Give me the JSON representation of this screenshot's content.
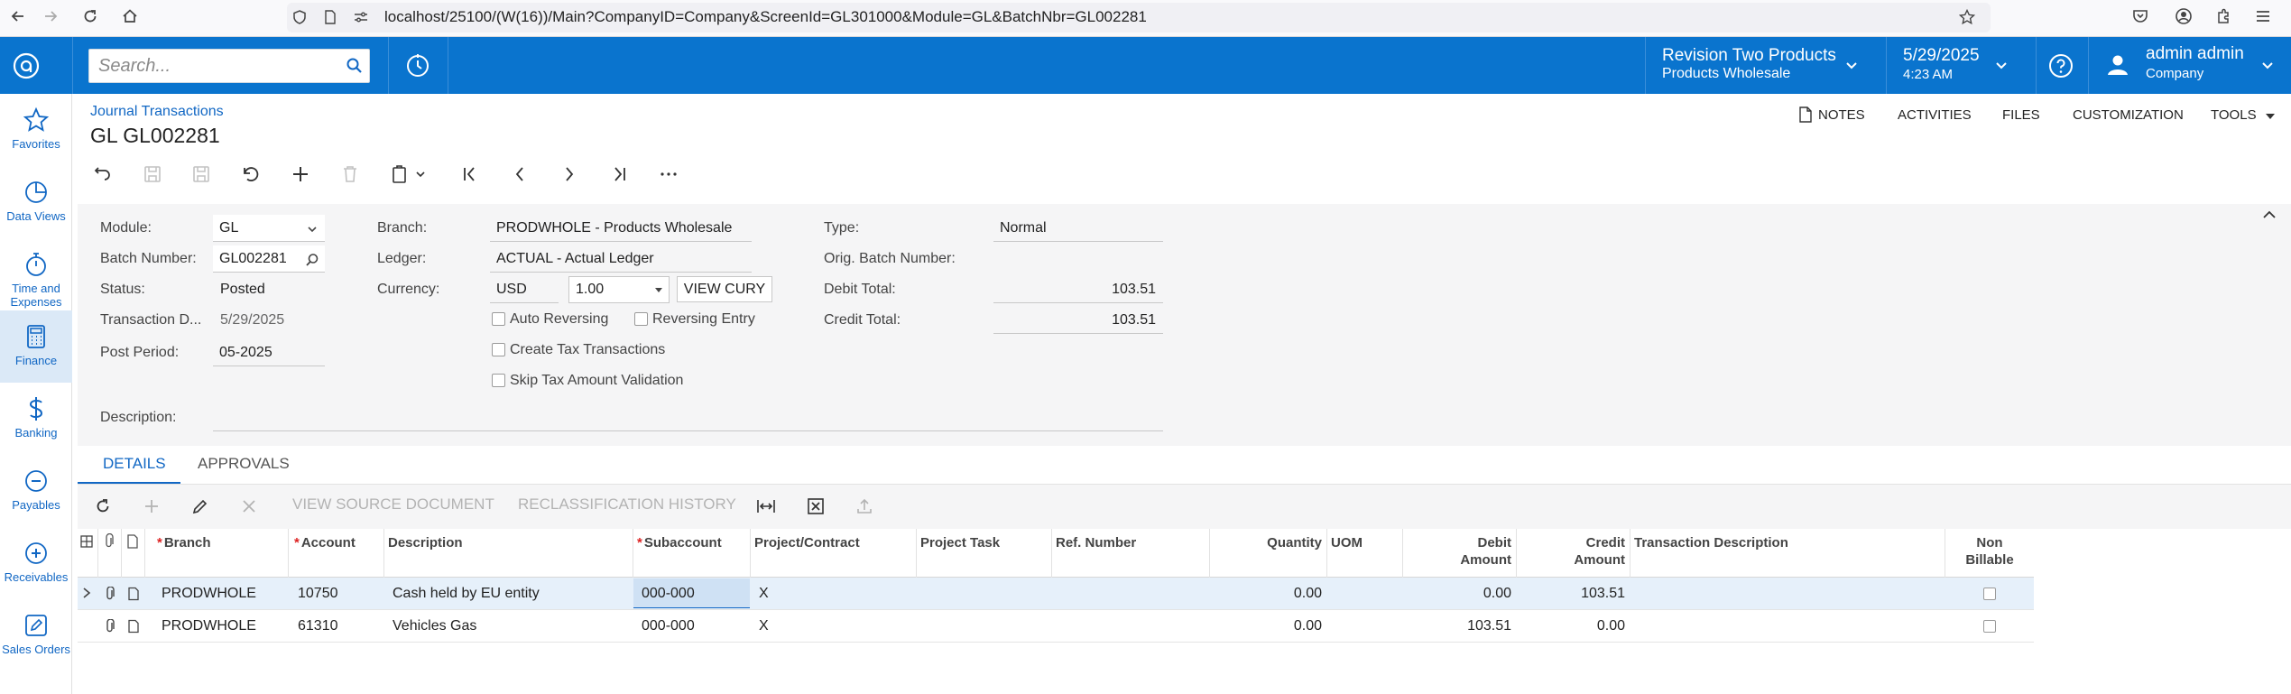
{
  "browser": {
    "url": "localhost/25100/(W(16))/Main?CompanyID=Company&ScreenId=GL301000&Module=GL&BatchNbr=GL002281"
  },
  "topbar": {
    "search_placeholder": "Search...",
    "company_name": "Revision Two Products",
    "company_branch": "Products Wholesale",
    "date": "5/29/2025",
    "time": "4:23 AM",
    "user_name": "admin admin",
    "user_company": "Company"
  },
  "sidebar": {
    "items": [
      {
        "label": "Favorites",
        "icon": "star-icon"
      },
      {
        "label": "Data Views",
        "icon": "pie-chart-icon"
      },
      {
        "label": "Time and Expenses",
        "icon": "stopwatch-icon"
      },
      {
        "label": "Finance",
        "icon": "calculator-icon"
      },
      {
        "label": "Banking",
        "icon": "dollar-icon"
      },
      {
        "label": "Payables",
        "icon": "minus-circle-icon"
      },
      {
        "label": "Receivables",
        "icon": "plus-circle-icon"
      },
      {
        "label": "Sales Orders",
        "icon": "pencil-icon"
      }
    ]
  },
  "header": {
    "breadcrumb": "Journal Transactions",
    "title": "GL GL002281",
    "menu": {
      "notes": "NOTES",
      "activities": "ACTIVITIES",
      "files": "FILES",
      "customization": "CUSTOMIZATION",
      "tools": "TOOLS"
    }
  },
  "form": {
    "module_label": "Module:",
    "module_value": "GL",
    "batch_label": "Batch Number:",
    "batch_value": "GL002281",
    "status_label": "Status:",
    "status_value": "Posted",
    "trandate_label": "Transaction D...",
    "trandate_value": "5/29/2025",
    "period_label": "Post Period:",
    "period_value": "05-2025",
    "branch_label": "Branch:",
    "branch_value": "PRODWHOLE - Products Wholesale",
    "ledger_label": "Ledger:",
    "ledger_value": "ACTUAL - Actual Ledger",
    "currency_label": "Currency:",
    "currency_value": "USD",
    "rate_value": "1.00",
    "view_cury": "VIEW CURY",
    "auto_reversing": "Auto Reversing",
    "reversing_entry": "Reversing Entry",
    "create_tax": "Create Tax Transactions",
    "skip_tax": "Skip Tax Amount Validation",
    "type_label": "Type:",
    "type_value": "Normal",
    "orig_label": "Orig. Batch Number:",
    "orig_value": "",
    "debit_label": "Debit Total:",
    "debit_value": "103.51",
    "credit_label": "Credit Total:",
    "credit_value": "103.51",
    "desc_label": "Description:",
    "desc_value": ""
  },
  "tabs": {
    "details": "DETAILS",
    "approvals": "APPROVALS"
  },
  "grid_toolbar": {
    "view_source": "VIEW SOURCE DOCUMENT",
    "reclass_history": "RECLASSIFICATION HISTORY"
  },
  "grid": {
    "headers": {
      "branch": "Branch",
      "account": "Account",
      "description": "Description",
      "subaccount": "Subaccount",
      "project": "Project/Contract",
      "task": "Project Task",
      "ref": "Ref. Number",
      "quantity": "Quantity",
      "uom": "UOM",
      "debit_1": "Debit",
      "debit_2": "Amount",
      "credit_1": "Credit",
      "credit_2": "Amount",
      "trandesc": "Transaction Description",
      "nonbill_1": "Non",
      "nonbill_2": "Billable"
    },
    "rows": [
      {
        "branch": "PRODWHOLE",
        "account": "10750",
        "description": "Cash held by EU entity",
        "subaccount": "000-000",
        "project": "X",
        "task": "",
        "ref": "",
        "quantity": "0.00",
        "uom": "",
        "debit": "0.00",
        "credit": "103.51",
        "trandesc": ""
      },
      {
        "branch": "PRODWHOLE",
        "account": "61310",
        "description": "Vehicles Gas",
        "subaccount": "000-000",
        "project": "X",
        "task": "",
        "ref": "",
        "quantity": "0.00",
        "uom": "",
        "debit": "103.51",
        "credit": "0.00",
        "trandesc": ""
      }
    ]
  }
}
